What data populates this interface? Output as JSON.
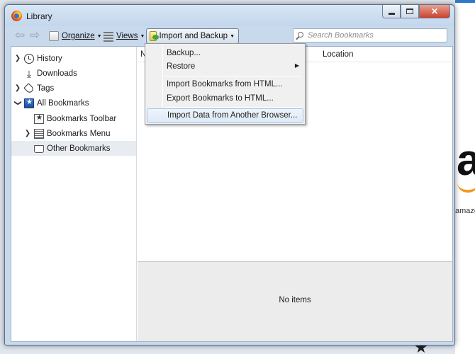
{
  "window": {
    "title": "Library"
  },
  "toolbar": {
    "back_icon": "arrow-left-icon",
    "forward_icon": "arrow-right-icon",
    "organize_label": "Organize",
    "views_label": "Views",
    "import_backup_label": "Import and Backup",
    "search_placeholder": "Search Bookmarks"
  },
  "sidebar": {
    "items": [
      {
        "label": "History",
        "icon": "clock-icon",
        "expandable": true
      },
      {
        "label": "Downloads",
        "icon": "download-icon",
        "expandable": false
      },
      {
        "label": "Tags",
        "icon": "tag-icon",
        "expandable": true
      },
      {
        "label": "All Bookmarks",
        "icon": "bookmarks-icon",
        "expanded": true
      },
      {
        "label": "Bookmarks Toolbar",
        "icon": "bookmarks-toolbar-icon",
        "expandable": false
      },
      {
        "label": "Bookmarks Menu",
        "icon": "bookmarks-menu-icon",
        "expandable": true
      },
      {
        "label": "Other Bookmarks",
        "icon": "other-bookmarks-icon",
        "selected": true
      }
    ]
  },
  "list": {
    "columns": [
      "N",
      "Location"
    ],
    "empty_text": "No items"
  },
  "import_menu": {
    "items": [
      {
        "label": "Backup..."
      },
      {
        "label": "Restore",
        "submenu": true
      },
      {
        "label": "Import Bookmarks from HTML..."
      },
      {
        "label": "Export Bookmarks to HTML..."
      },
      {
        "label": "Import Data from Another Browser...",
        "highlighted": true
      }
    ]
  },
  "background": {
    "page_logo_letter": "a",
    "page_text": "amazo"
  },
  "colors": {
    "window_frame": "#c9d9ec",
    "menu_highlight": "#dde9f6",
    "close_button": "#c8432c",
    "selection": "#e8ecf1"
  }
}
